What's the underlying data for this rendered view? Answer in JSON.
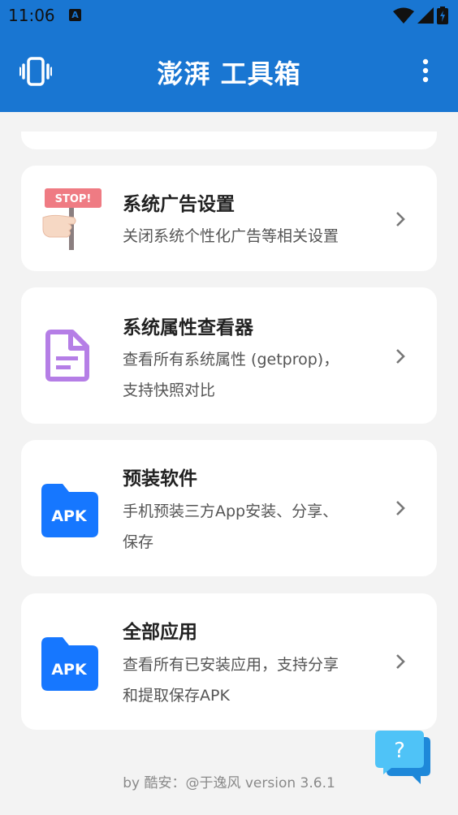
{
  "status_bar": {
    "time": "11:06",
    "notification_glyph": "A"
  },
  "app_bar": {
    "title": "澎湃 工具箱",
    "left_icon": "vibrate-icon",
    "right_icon": "more-vert-icon"
  },
  "cards": [
    {
      "title": "系统广告设置",
      "desc_line1": "关闭系统个性化广告等相关设置",
      "desc_line2": "",
      "icon": "stop-sign-icon"
    },
    {
      "title": "系统属性查看器",
      "desc_line1": "查看所有系统属性 (getprop)，",
      "desc_line2": "支持快照对比",
      "icon": "document-icon"
    },
    {
      "title": "预装软件",
      "desc_line1": "手机预装三方App安装、分享、",
      "desc_line2": "保存",
      "icon": "apk-folder-icon",
      "icon_label": "APK"
    },
    {
      "title": "全部应用",
      "desc_line1": "查看所有已安装应用，支持分享",
      "desc_line2": "和提取保存APK",
      "icon": "apk-folder-icon",
      "icon_label": "APK"
    }
  ],
  "stop_sign_text": "STOP!",
  "footer": "by 酷安：@于逸风 version 3.6.1",
  "help_button": {
    "glyph": "?"
  },
  "colors": {
    "primary": "#1976d2",
    "purple": "#b57ee6",
    "apk_blue": "#1677ff",
    "help_blue": "#29a9e8"
  }
}
